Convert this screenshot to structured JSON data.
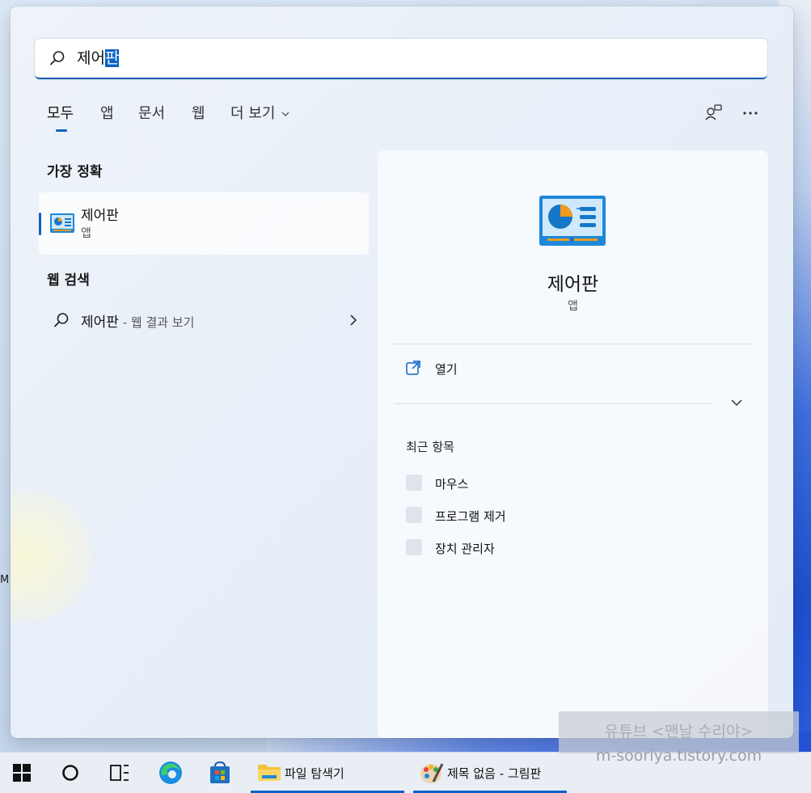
{
  "search": {
    "value_plain": "제어",
    "value_selected": "판"
  },
  "tabs": [
    {
      "label": "모두",
      "active": true
    },
    {
      "label": "앱"
    },
    {
      "label": "문서"
    },
    {
      "label": "웹"
    },
    {
      "label": "더 보기"
    }
  ],
  "top_right_icons": [
    "feedback-icon",
    "more-icon"
  ],
  "best_match": {
    "title": "가장 정확",
    "item": {
      "name": "제어판",
      "type": "앱",
      "icon": "control-panel-icon"
    }
  },
  "web_search": {
    "title": "웹 검색",
    "item": {
      "query": "제어판",
      "hint": " - 웹 결과 보기"
    }
  },
  "detail": {
    "name": "제어판",
    "type": "앱",
    "open_label": "열기",
    "recent_title": "최근 항목",
    "recent_items": [
      "마우스",
      "프로그램 제거",
      "장치 관리자"
    ]
  },
  "watermark": {
    "line1": "유튜브 <맨날 수리야>",
    "line2": "m-sooriya.tistory.com"
  },
  "taskbar": {
    "icons": [
      "windows-start-icon",
      "search-circle-icon",
      "task-view-icon",
      "edge-icon",
      "store-icon"
    ],
    "apps": [
      {
        "label": "파일 탐색기",
        "icon": "folder-icon"
      },
      {
        "label": "제목 없음 - 그림판",
        "icon": "paint-icon"
      }
    ]
  },
  "colors": {
    "accent": "#0b63c5"
  },
  "left_edge_text": "M"
}
